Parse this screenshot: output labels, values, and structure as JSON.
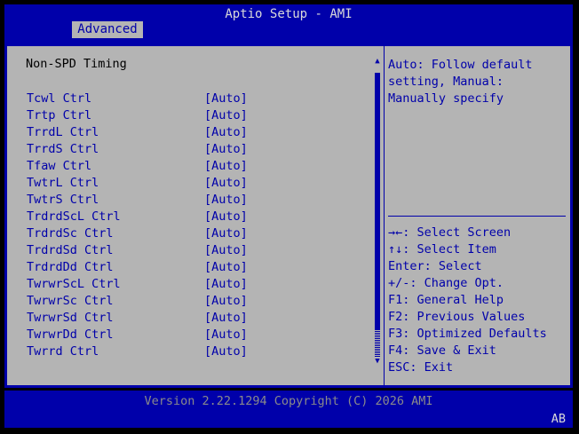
{
  "header": {
    "title": "Aptio Setup - AMI",
    "tab": "Advanced"
  },
  "main": {
    "section_title": "Non-SPD Timing",
    "settings": [
      {
        "label": "Tcwl Ctrl",
        "value": "[Auto]"
      },
      {
        "label": "Trtp Ctrl",
        "value": "[Auto]"
      },
      {
        "label": "TrrdL Ctrl",
        "value": "[Auto]"
      },
      {
        "label": "TrrdS Ctrl",
        "value": "[Auto]"
      },
      {
        "label": "Tfaw Ctrl",
        "value": "[Auto]"
      },
      {
        "label": "TwtrL Ctrl",
        "value": "[Auto]"
      },
      {
        "label": "TwtrS Ctrl",
        "value": "[Auto]"
      },
      {
        "label": "TrdrdScL Ctrl",
        "value": "[Auto]"
      },
      {
        "label": "TrdrdSc Ctrl",
        "value": "[Auto]"
      },
      {
        "label": "TrdrdSd Ctrl",
        "value": "[Auto]"
      },
      {
        "label": "TrdrdDd Ctrl",
        "value": "[Auto]"
      },
      {
        "label": "TwrwrScL Ctrl",
        "value": "[Auto]"
      },
      {
        "label": "TwrwrSc Ctrl",
        "value": "[Auto]"
      },
      {
        "label": "TwrwrSd Ctrl",
        "value": "[Auto]"
      },
      {
        "label": "TwrwrDd Ctrl",
        "value": "[Auto]"
      },
      {
        "label": "Twrrd Ctrl",
        "value": "[Auto]"
      }
    ]
  },
  "help": {
    "description": "Auto: Follow default\nsetting, Manual:\nManually specify",
    "keys": [
      "→←: Select Screen",
      "↑↓: Select Item",
      "Enter: Select",
      "+/-: Change Opt.",
      "F1: General Help",
      "F2: Previous Values",
      "F3: Optimized Defaults",
      "F4: Save & Exit",
      "ESC: Exit"
    ]
  },
  "footer": {
    "version": "Version 2.22.1294 Copyright (C) 2026 AMI",
    "badge": "AB"
  },
  "scrollbar": {
    "up_glyph": "▲",
    "down_glyph": "▼"
  },
  "colors": {
    "bios_blue": "#0000aa",
    "panel_gray": "#b4b4b4",
    "title_text": "#dadada"
  }
}
